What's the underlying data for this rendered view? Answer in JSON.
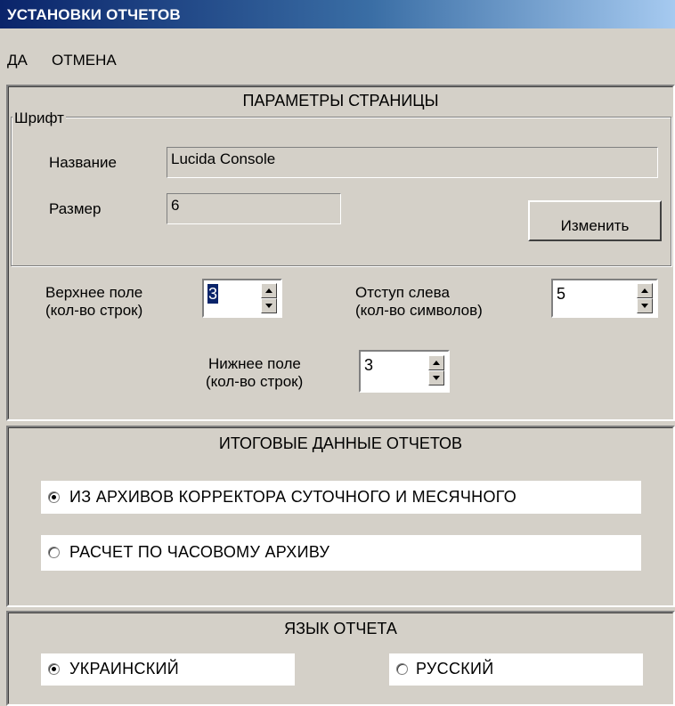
{
  "window": {
    "title": "УСТАНОВКИ ОТЧЕТОВ"
  },
  "menu": {
    "ok": "ДА",
    "cancel": "ОТМЕНА"
  },
  "page_params": {
    "heading": "ПАРАМЕТРЫ СТРАНИЦЫ",
    "font_group": "Шрифт",
    "name_label": "Название",
    "name_value": "Lucida Console",
    "size_label": "Размер",
    "size_value": "6",
    "change_button": "Изменить",
    "top_margin_label": "Верхнее поле",
    "top_margin_sub": "(кол-во строк)",
    "top_margin_value": "3",
    "left_indent_label": "Отступ слева",
    "left_indent_sub": "(кол-во символов)",
    "left_indent_value": "5",
    "bottom_margin_label": "Нижнее поле",
    "bottom_margin_sub": "(кол-во строк)",
    "bottom_margin_value": "3"
  },
  "totals": {
    "heading": "ИТОГОВЫЕ ДАННЫЕ ОТЧЕТОВ",
    "options": [
      {
        "label": "ИЗ АРХИВОВ КОРРЕКТОРА СУТОЧНОГО И МЕСЯЧНОГО",
        "selected": true
      },
      {
        "label": "РАСЧЕТ ПО ЧАСОВОМУ АРХИВУ",
        "selected": false
      }
    ]
  },
  "language": {
    "heading": "ЯЗЫК ОТЧЕТА",
    "options": [
      {
        "label": "УКРАИНСКИЙ",
        "selected": true
      },
      {
        "label": "РУССКИЙ",
        "selected": false
      }
    ]
  },
  "colors": {
    "titlebar_start": "#0a246a",
    "face": "#d4d0c8"
  }
}
